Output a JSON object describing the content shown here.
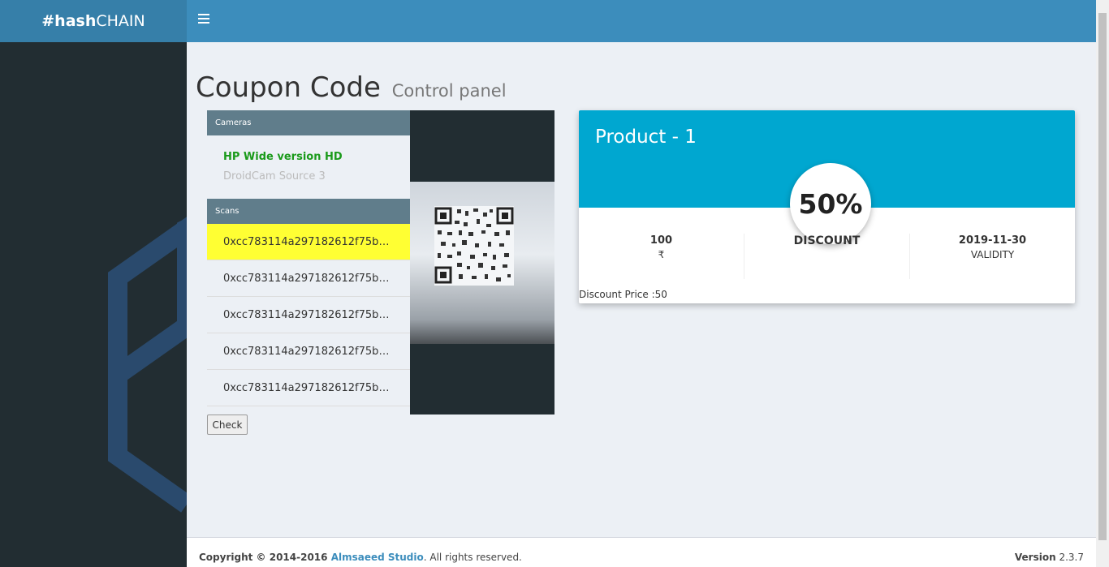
{
  "brand": {
    "bold": "#hash",
    "rest": "CHAIN"
  },
  "page": {
    "title": "Coupon Code",
    "subtitle": "Control panel"
  },
  "cameras": {
    "header": "Cameras",
    "items": [
      "HP Wide version HD",
      "DroidCam Source 3"
    ]
  },
  "scans": {
    "header": "Scans",
    "items": [
      "0xcc783114a297182612f75b1600a...",
      "0xcc783114a297182612f75b1600a...",
      "0xcc783114a297182612f75b1600a...",
      "0xcc783114a297182612f75b1600a...",
      "0xcc783114a297182612f75b1600a..."
    ]
  },
  "check_label": "Check",
  "product": {
    "name": "Product - 1",
    "discount_percent": "50%",
    "price": "100",
    "currency": "₹",
    "discount_label": "DISCOUNT",
    "validity_date": "2019-11-30",
    "validity_label": "VALIDITY",
    "discount_price": "Discount Price :50"
  },
  "footer": {
    "copyright_prefix": "Copyright © 2014-2016 ",
    "company": "Almsaeed Studio",
    "rights": ". All rights reserved.",
    "version_label": "Version",
    "version": "2.3.7"
  },
  "colors": {
    "navbar": "#3c8dbc",
    "logo_bg": "#367fa9",
    "sidebar": "#222d32",
    "card_header": "#00a7d0",
    "scan_highlight": "#ffff33",
    "camera_active": "#1a9a1a"
  }
}
